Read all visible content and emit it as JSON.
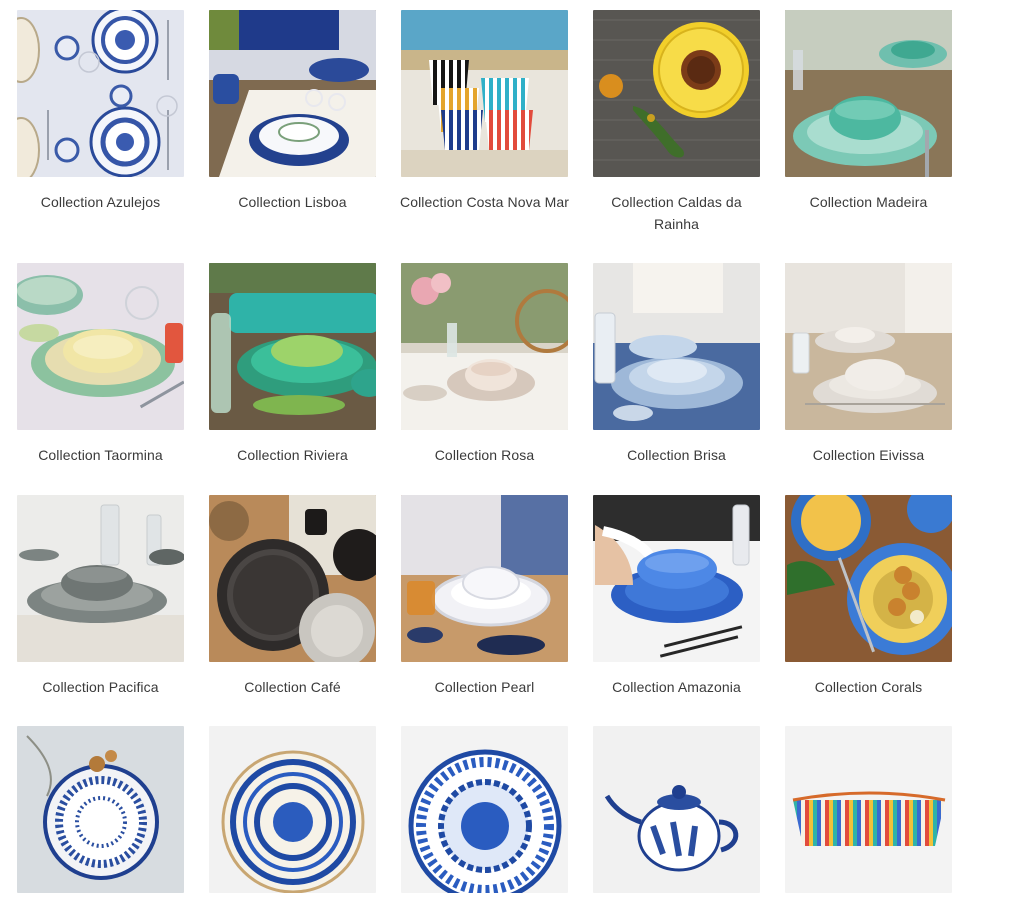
{
  "collections": [
    {
      "label": "Collection Azulejos",
      "icon": "azulejos-plates-photo"
    },
    {
      "label": "Collection Lisboa",
      "icon": "lisboa-table-photo"
    },
    {
      "label": "Collection Costa Nova Mar",
      "icon": "striped-mugs-photo"
    },
    {
      "label": "Collection Caldas da Rainha",
      "icon": "sunflower-plate-photo"
    },
    {
      "label": "Collection Madeira",
      "icon": "madeira-bowls-photo"
    },
    {
      "label": "Collection Taormina",
      "icon": "taormina-plates-photo"
    },
    {
      "label": "Collection Riviera",
      "icon": "riviera-plates-photo"
    },
    {
      "label": "Collection Rosa",
      "icon": "rosa-table-photo"
    },
    {
      "label": "Collection Brisa",
      "icon": "brisa-table-photo"
    },
    {
      "label": "Collection Eivissa",
      "icon": "eivissa-table-photo"
    },
    {
      "label": "Collection Pacifica",
      "icon": "pacifica-plates-photo"
    },
    {
      "label": "Collection Café",
      "icon": "cafe-plates-photo"
    },
    {
      "label": "Collection Pearl",
      "icon": "pearl-plates-photo"
    },
    {
      "label": "Collection Amazonia",
      "icon": "amazonia-plates-photo"
    },
    {
      "label": "Collection Corals",
      "icon": "corals-plates-photo"
    },
    {
      "label": "",
      "icon": "blue-pattern-plate-photo"
    },
    {
      "label": "",
      "icon": "blue-ring-plate-photo"
    },
    {
      "label": "",
      "icon": "blue-floral-plate-photo"
    },
    {
      "label": "",
      "icon": "teapot-photo"
    },
    {
      "label": "",
      "icon": "striped-basket-photo"
    }
  ]
}
